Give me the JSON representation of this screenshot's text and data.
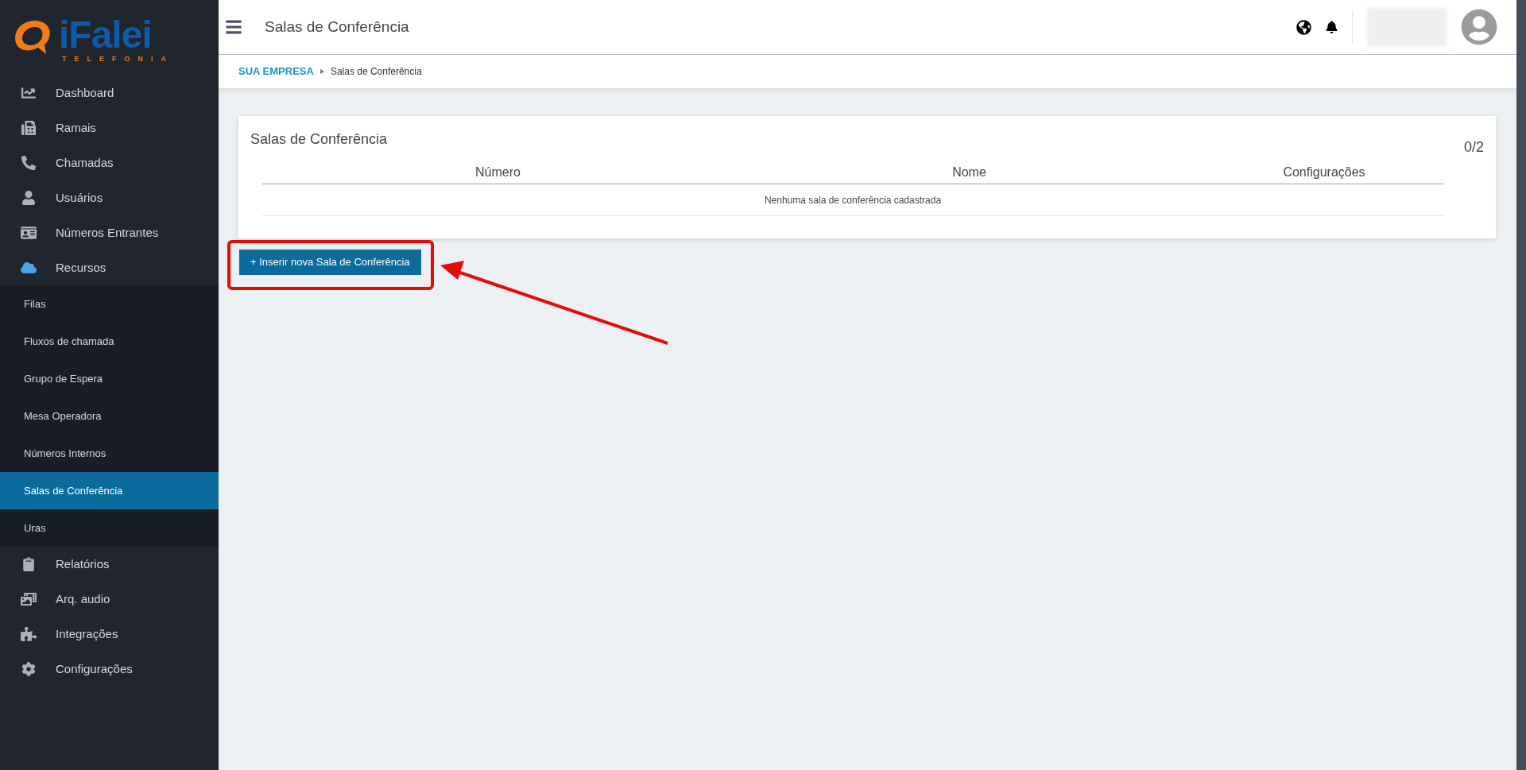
{
  "logo": {
    "name": "iFalei",
    "tagline": "TELEFONIA"
  },
  "sidebar": {
    "items": [
      {
        "label": "Dashboard",
        "kind": "main",
        "selected": false
      },
      {
        "label": "Ramais",
        "kind": "main",
        "selected": false
      },
      {
        "label": "Chamadas",
        "kind": "main",
        "selected": false
      },
      {
        "label": "Usuários",
        "kind": "main",
        "selected": false
      },
      {
        "label": "Números Entrantes",
        "kind": "main",
        "selected": false
      },
      {
        "label": "Recursos",
        "kind": "main",
        "selected": false
      },
      {
        "label": "Filas",
        "kind": "sub",
        "selected": false
      },
      {
        "label": "Fluxos de chamada",
        "kind": "sub",
        "selected": false
      },
      {
        "label": "Grupo de Espera",
        "kind": "sub",
        "selected": false
      },
      {
        "label": "Mesa Operadora",
        "kind": "sub",
        "selected": false
      },
      {
        "label": "Números Internos",
        "kind": "sub",
        "selected": false
      },
      {
        "label": "Salas de Conferência",
        "kind": "sub",
        "selected": true
      },
      {
        "label": "Uras",
        "kind": "sub",
        "selected": false
      },
      {
        "label": "Relatórios",
        "kind": "main",
        "selected": false
      },
      {
        "label": "Arq. audio",
        "kind": "main",
        "selected": false
      },
      {
        "label": "Integrações",
        "kind": "main",
        "selected": false
      },
      {
        "label": "Configurações",
        "kind": "main",
        "selected": false
      }
    ]
  },
  "header": {
    "title": "Salas de Conferência"
  },
  "breadcrumb": [
    "SUA EMPRESA",
    "Salas de Conferência"
  ],
  "card": {
    "title": "Salas de Conferência",
    "count": "0/2",
    "table": {
      "columns": [
        "Número",
        "Nome",
        "Configurações"
      ],
      "empty_message": "Nenhuma sala de conferência cadastrada"
    }
  },
  "add_button": "+ Inserir nova Sala de Conferência"
}
